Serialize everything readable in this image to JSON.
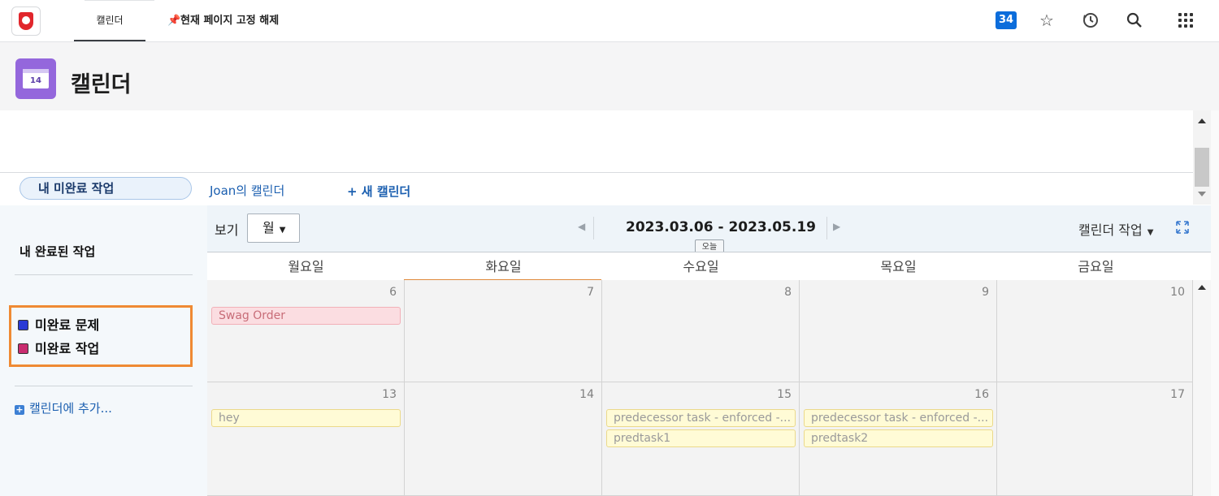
{
  "topbar": {
    "tab_label": "캘린더",
    "unpin_label": "현재 페이지 고정 해제",
    "badge_count": "34",
    "icons": [
      "star-icon",
      "history-icon",
      "search-icon",
      "apps-grid-icon"
    ]
  },
  "header": {
    "title": "캘린더",
    "logo_day": "14"
  },
  "calendar_tabs": {
    "mine": "내 미완료 작업",
    "joan": "Joan의 캘린더",
    "new": "+ 새 캘린더"
  },
  "sidebar": {
    "title": "내 완료된 작업",
    "legend": [
      {
        "label": "미완료 문제",
        "color": "#2b3bd6"
      },
      {
        "label": "미완료 작업",
        "color": "#c92c6f"
      }
    ],
    "add_calendar": "캘린더에 추가..."
  },
  "toolbar": {
    "view_label": "보기",
    "view_value": "월",
    "date_range": "2023.03.06 - 2023.05.19",
    "today": "오늘",
    "calendar_actions": "캘린더 작업"
  },
  "calendar": {
    "days": [
      "월요일",
      "화요일",
      "수요일",
      "목요일",
      "금요일"
    ],
    "weeks": [
      {
        "dates": [
          "6",
          "7",
          "8",
          "9",
          "10"
        ],
        "events": [
          [
            {
              "label": "Swag Order",
              "kind": "issue"
            }
          ],
          [],
          [],
          [],
          []
        ]
      },
      {
        "dates": [
          "13",
          "14",
          "15",
          "16",
          "17"
        ],
        "events": [
          [
            {
              "label": "hey",
              "kind": "task"
            }
          ],
          [],
          [
            {
              "label": "predecessor task - enforced -...",
              "kind": "task"
            },
            {
              "label": "predtask1",
              "kind": "task"
            }
          ],
          [
            {
              "label": "predecessor task - enforced -...",
              "kind": "task"
            },
            {
              "label": "predtask2",
              "kind": "task"
            }
          ],
          []
        ]
      }
    ]
  }
}
